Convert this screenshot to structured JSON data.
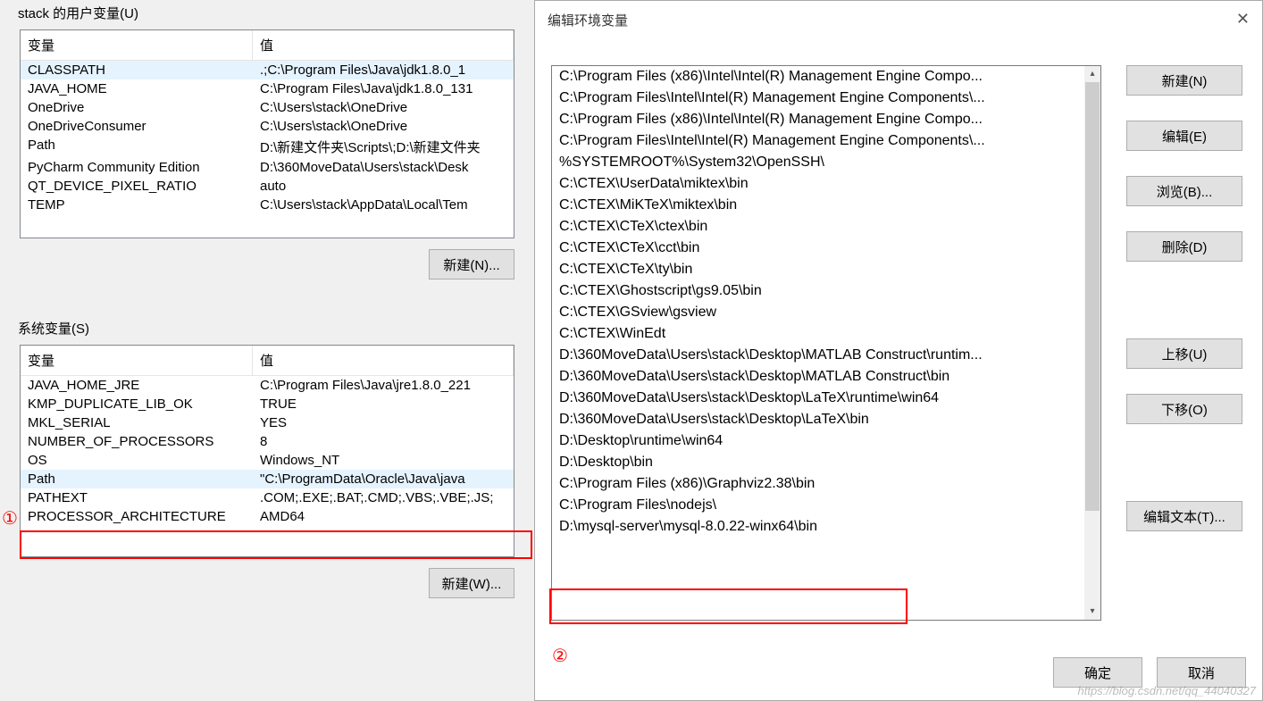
{
  "leftPanel": {
    "userVarsTitle": "stack 的用户变量(U)",
    "sysVarsTitle": "系统变量(S)",
    "header": {
      "variable": "变量",
      "value": "值"
    },
    "userVars": [
      {
        "name": "CLASSPATH",
        "val": ".;C:\\Program Files\\Java\\jdk1.8.0_1"
      },
      {
        "name": "JAVA_HOME",
        "val": "C:\\Program Files\\Java\\jdk1.8.0_131"
      },
      {
        "name": "OneDrive",
        "val": "C:\\Users\\stack\\OneDrive"
      },
      {
        "name": "OneDriveConsumer",
        "val": "C:\\Users\\stack\\OneDrive"
      },
      {
        "name": "Path",
        "val": "D:\\新建文件夹\\Scripts\\;D:\\新建文件夹"
      },
      {
        "name": "PyCharm Community Edition",
        "val": "D:\\360MoveData\\Users\\stack\\Desk"
      },
      {
        "name": "QT_DEVICE_PIXEL_RATIO",
        "val": "auto"
      },
      {
        "name": "TEMP",
        "val": "C:\\Users\\stack\\AppData\\Local\\Tem"
      }
    ],
    "sysVars": [
      {
        "name": "JAVA_HOME_JRE",
        "val": "C:\\Program Files\\Java\\jre1.8.0_221"
      },
      {
        "name": "KMP_DUPLICATE_LIB_OK",
        "val": "TRUE"
      },
      {
        "name": "MKL_SERIAL",
        "val": "YES"
      },
      {
        "name": "NUMBER_OF_PROCESSORS",
        "val": "8"
      },
      {
        "name": "OS",
        "val": "Windows_NT"
      },
      {
        "name": "Path",
        "val": "\"C:\\ProgramData\\Oracle\\Java\\java"
      },
      {
        "name": "PATHEXT",
        "val": ".COM;.EXE;.BAT;.CMD;.VBS;.VBE;.JS;"
      },
      {
        "name": "PROCESSOR_ARCHITECTURE",
        "val": "AMD64"
      }
    ],
    "sysSelectedIndex": 5,
    "btns": {
      "newN": "新建(N)...",
      "newW": "新建(W)..."
    }
  },
  "dialog": {
    "title": "编辑环境变量",
    "paths": [
      "C:\\Program Files (x86)\\Intel\\Intel(R) Management Engine Compo...",
      "C:\\Program Files\\Intel\\Intel(R) Management Engine Components\\...",
      "C:\\Program Files (x86)\\Intel\\Intel(R) Management Engine Compo...",
      "C:\\Program Files\\Intel\\Intel(R) Management Engine Components\\...",
      "%SYSTEMROOT%\\System32\\OpenSSH\\",
      "C:\\CTEX\\UserData\\miktex\\bin",
      "C:\\CTEX\\MiKTeX\\miktex\\bin",
      "C:\\CTEX\\CTeX\\ctex\\bin",
      "C:\\CTEX\\CTeX\\cct\\bin",
      "C:\\CTEX\\CTeX\\ty\\bin",
      "C:\\CTEX\\Ghostscript\\gs9.05\\bin",
      "C:\\CTEX\\GSview\\gsview",
      "C:\\CTEX\\WinEdt",
      "D:\\360MoveData\\Users\\stack\\Desktop\\MATLAB Construct\\runtim...",
      "D:\\360MoveData\\Users\\stack\\Desktop\\MATLAB Construct\\bin",
      "D:\\360MoveData\\Users\\stack\\Desktop\\LaTeX\\runtime\\win64",
      "D:\\360MoveData\\Users\\stack\\Desktop\\LaTeX\\bin",
      "D:\\Desktop\\runtime\\win64",
      "D:\\Desktop\\bin",
      "C:\\Program Files (x86)\\Graphviz2.38\\bin",
      "C:\\Program Files\\nodejs\\",
      "D:\\mysql-server\\mysql-8.0.22-winx64\\bin"
    ],
    "btns": {
      "new": "新建(N)",
      "edit": "编辑(E)",
      "browse": "浏览(B)...",
      "delete": "删除(D)",
      "up": "上移(U)",
      "down": "下移(O)",
      "editText": "编辑文本(T)...",
      "ok": "确定",
      "cancel": "取消"
    }
  },
  "annotations": {
    "circ1": "①",
    "circ2": "②"
  },
  "watermark": "https://blog.csdn.net/qq_44040327"
}
